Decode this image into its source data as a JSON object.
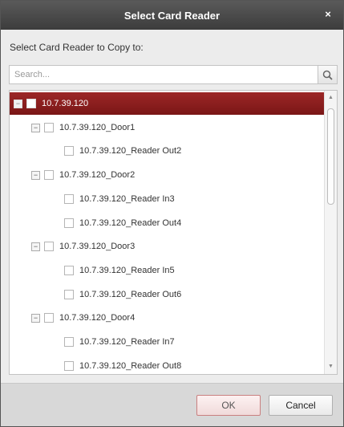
{
  "dialog": {
    "title": "Select Card Reader",
    "close_glyph": "×",
    "prompt": "Select Card Reader to Copy to:",
    "search": {
      "placeholder": "Search...",
      "value": ""
    },
    "tree": {
      "root": {
        "label": "10.7.39.120",
        "expanded": true,
        "selected": true
      },
      "doors": [
        {
          "label": "10.7.39.120_Door1",
          "readers": [
            "10.7.39.120_Reader Out2"
          ]
        },
        {
          "label": "10.7.39.120_Door2",
          "readers": [
            "10.7.39.120_Reader In3",
            "10.7.39.120_Reader Out4"
          ]
        },
        {
          "label": "10.7.39.120_Door3",
          "readers": [
            "10.7.39.120_Reader In5",
            "10.7.39.120_Reader Out6"
          ]
        },
        {
          "label": "10.7.39.120_Door4",
          "readers": [
            "10.7.39.120_Reader In7",
            "10.7.39.120_Reader Out8"
          ]
        }
      ]
    },
    "buttons": {
      "ok": "OK",
      "cancel": "Cancel"
    },
    "colors": {
      "selected_row": "#8a1d1d",
      "titlebar": "#474747"
    },
    "icons": {
      "search": "search-icon",
      "close": "close-icon"
    }
  }
}
